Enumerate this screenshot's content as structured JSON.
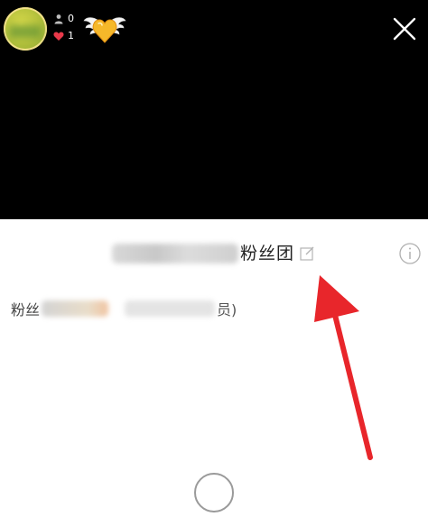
{
  "header": {
    "viewer_count": "0",
    "like_count": "1",
    "icons": {
      "viewer": "person-icon",
      "like": "heart-icon",
      "badge": "winged-heart-icon",
      "close": "close-icon"
    }
  },
  "panel": {
    "title_suffix": "粉丝团",
    "fans_label": "粉丝",
    "fans_suffix": "员)",
    "icons": {
      "edit": "edit-icon",
      "info": "info-icon"
    }
  },
  "annotation": {
    "arrow_color": "#e8262b"
  },
  "colors": {
    "video_background": "#000000",
    "panel_background": "#ffffff",
    "heart": "#e8394a",
    "badge_gold": "#f5b82a"
  }
}
